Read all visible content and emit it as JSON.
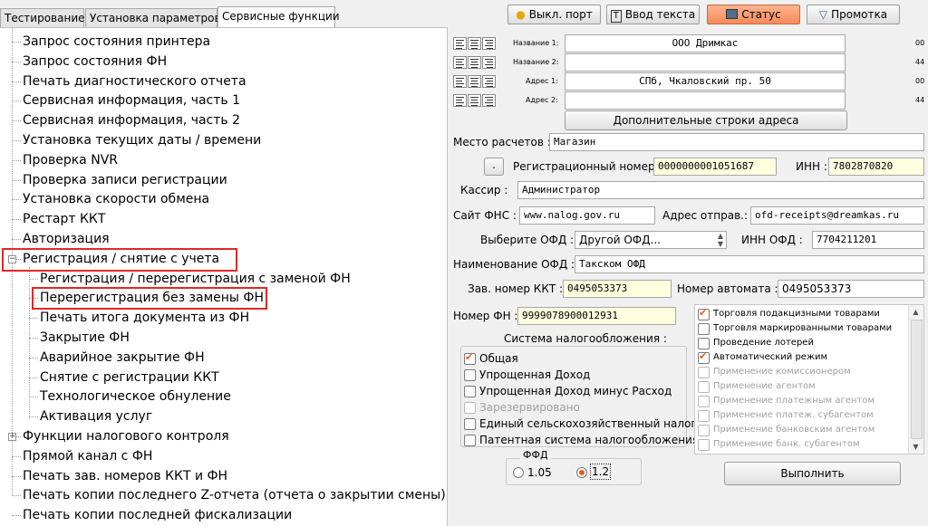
{
  "tabs": [
    "Тестирование",
    "Установка параметров",
    "Сервисные функции"
  ],
  "toolbar": {
    "port_btn": "Выкл. порт",
    "text_btn": "Ввод текста",
    "status_btn": "Статус",
    "scroll_btn": "Промотка"
  },
  "tree": {
    "top_items": [
      "Запрос состояния принтера",
      "Запрос состояния ФН",
      "Печать диагностического отчета",
      "Сервисная информация, часть 1",
      "Сервисная информация, часть 2",
      "Установка текущих даты / времени",
      "Проверка NVR",
      "Проверка записи регистрации",
      "Установка скорости обмена",
      "Рестарт ККТ",
      "Авторизация"
    ],
    "registration_group": "Регистрация / снятие с учета",
    "registration_children": [
      "Регистрация / перерегистрация с заменой ФН",
      "Перерегистрация без замены ФН",
      "Печать итога документа из ФН",
      "Закрытие ФН",
      "Аварийное закрытие ФН",
      "Снятие с регистрации ККТ",
      "Технологическое обнуление",
      "Активация услуг"
    ],
    "tax_group": "Функции налогового контроля",
    "bottom_items": [
      "Прямой канал с ФН",
      "Печать зав. номеров ККТ и ФН",
      "Печать копии последнего Z-отчета (отчета о закрытии смены)",
      "Печать копии последней фискализации"
    ]
  },
  "header_fields": {
    "name1_label": "Название 1:",
    "name1_value": "ООО Дримкас",
    "name2_label": "Название 2:",
    "name2_value": "",
    "addr1_label": "Адрес 1:",
    "addr1_value": "СПб, Чкаловский пр. 50",
    "addr2_label": "Адрес 2:",
    "addr2_value": "",
    "counter1": "00",
    "counter2": "44",
    "counter3": "00",
    "counter4": "44",
    "more_addr_btn": "Дополнительные строки адреса"
  },
  "form": {
    "place_label": "Место расчетов :",
    "place_value": "Магазин",
    "small_btn": ".",
    "reg_num_label": "Регистрационный номер :",
    "reg_num_value": "0000000001051687",
    "inn_label": "ИНН :",
    "inn_value": "7802870820",
    "cashier_label": "Кассир :",
    "cashier_value": "Администратор",
    "fns_label": "Сайт ФНС :",
    "fns_value": "www.nalog.gov.ru",
    "sender_label": "Адрес отправ.:",
    "sender_value": "ofd-receipts@dreamkas.ru",
    "ofd_select_label": "Выберите ОФД :",
    "ofd_select_value": "Другой ОФД...",
    "ofd_inn_label": "ИНН ОФД :",
    "ofd_inn_value": "7704211201",
    "ofd_name_label": "Наименование ОФД :",
    "ofd_name_value": "Такском ОФД",
    "kkt_num_label": "Зав. номер ККТ :",
    "kkt_num_value": "0495053373",
    "automat_label": "Номер автомата :",
    "automat_value": "0495053373",
    "fn_num_label": "Номер ФН :",
    "fn_num_value": "9999078900012931"
  },
  "tax_system": {
    "title": "Система  налогообложения :",
    "options": [
      {
        "label": "Общая",
        "checked": true,
        "disabled": false
      },
      {
        "label": "Упрощенная Доход",
        "checked": false,
        "disabled": false
      },
      {
        "label": "Упрощенная Доход минус Расход",
        "checked": false,
        "disabled": false
      },
      {
        "label": "Зарезервировано",
        "checked": false,
        "disabled": true
      },
      {
        "label": "Единый сельскохозяйственный налог",
        "checked": false,
        "disabled": false
      },
      {
        "label": "Патентная система налогообложения",
        "checked": false,
        "disabled": false
      }
    ]
  },
  "modes": {
    "options": [
      {
        "label": "Торговля подакцизными товарами",
        "checked": true,
        "disabled": false
      },
      {
        "label": "Торговля маркированными товарами",
        "checked": false,
        "disabled": false
      },
      {
        "label": "Проведение лотерей",
        "checked": false,
        "disabled": false
      },
      {
        "label": "Автоматический режим",
        "checked": true,
        "disabled": false
      },
      {
        "label": "Применение комиссионером",
        "checked": false,
        "disabled": true
      },
      {
        "label": "Применение агентом",
        "checked": false,
        "disabled": true
      },
      {
        "label": "Применение платежным агентом",
        "checked": false,
        "disabled": true
      },
      {
        "label": "Применение платеж. субагентом",
        "checked": false,
        "disabled": true
      },
      {
        "label": "Применение банковским агентом",
        "checked": false,
        "disabled": true
      },
      {
        "label": "Применение банк. субагентом",
        "checked": false,
        "disabled": true
      }
    ]
  },
  "ffd": {
    "title": "ФФД",
    "opt1": "1.05",
    "opt2": "1.2",
    "selected": "1.2"
  },
  "execute_btn": "Выполнить"
}
